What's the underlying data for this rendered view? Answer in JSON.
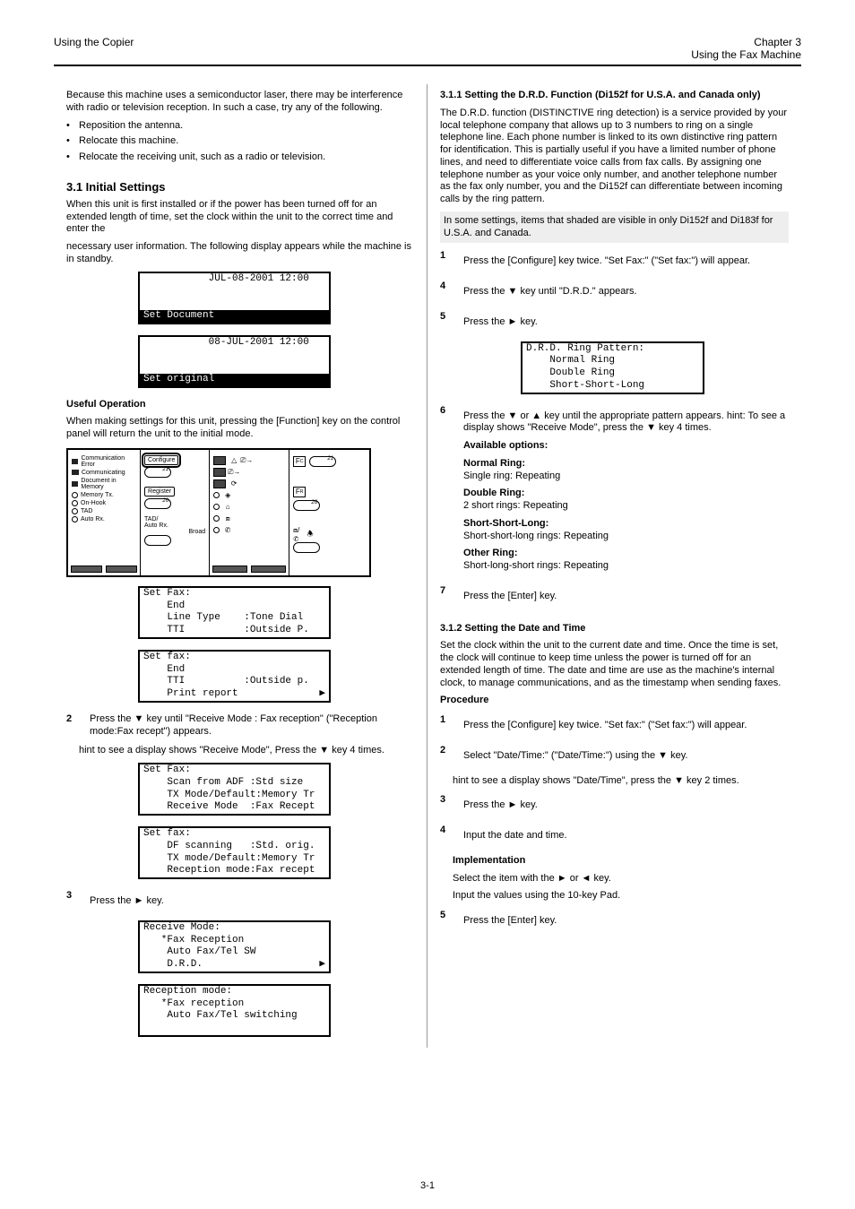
{
  "header": {
    "left": "Using the Copier",
    "right_ch": "Chapter 3",
    "right_title": "Using the Fax Machine"
  },
  "intro": {
    "p1": "Because this machine uses a semiconductor laser, there may be interference with radio or television reception. In such a case, try any of the following.",
    "b1": "Reposition the antenna.",
    "b2": "Relocate this machine.",
    "b3": "Relocate the receiving unit, such as a radio or television."
  },
  "s31": {
    "title": "3.1  Initial Settings",
    "p1a": "When this unit is first installed or if the power has been turned off for an extended length of time, set the clock within the unit to the correct time and enter the",
    "p1b": "necessary user information. The following display appears while the machine is in standby.",
    "disp1_top": "           JUL-08-2001 12:00",
    "disp1_bot": "Set Document",
    "disp1_blank": "                            ",
    "disp2_top": "           08-JUL-2001 12:00",
    "disp2_bot": "Set original"
  },
  "useful": {
    "title": "Useful Operation",
    "p": "When making settings for this unit, pressing the [Function] key on the control panel will return the unit to the initial mode.",
    "panel": {
      "col1": [
        "Communication Error",
        "Communicating",
        "Document in Memory",
        "Memory Tx.",
        "On-Hook",
        "TAD",
        "Auto Rx."
      ],
      "cfg": "Configure",
      "reg": "Register",
      "tad": "TAD/\nAuto Rx.",
      "broad": "Broad"
    }
  },
  "s311": {
    "title": "3.1.1 Setting the D.R.D. Function (Di152f for U.S.A. and Canada only)",
    "p": "The D.R.D. function (DISTINCTIVE ring detection) is a service provided by your local telephone company that allows up to 3 numbers to ring on a single telephone line. Each phone number is linked to its own distinctive ring pattern for identification. This is partially useful if you have a limited number of phone lines, and need to differentiate voice calls from fax calls. By assigning one telephone number as your voice only number, and another telephone number as the fax only number, you and the Di152f can differentiate between incoming calls by the ring pattern."
  },
  "shading_note": "In some settings, items that shaded are visible in only Di152f and Di183f for U.S.A. and Canada.",
  "step1": {
    "num": "1",
    "text": "Press the [Configure] key twice. \"Set Fax:\" (\"Set fax:\") will appear."
  },
  "sf1": {
    "title": "Set Fax:",
    "l1": "    End",
    "l2": "    Line Type    :Tone Dial",
    "l3": "    TTI          :Outside P."
  },
  "sf2": {
    "title": "Set fax:",
    "l1": "    End",
    "l2": "    TTI          :Outside p.",
    "l3": "    Print report"
  },
  "step2": {
    "num": "2",
    "text_a": "Press the ▼ key until \"Receive Mode : Fax reception\" (\"Reception mode:Fax recept\") appears.",
    "text_b": "hint to see a display shows \"Receive Mode\", Press the ▼ key 4 times."
  },
  "sf3": {
    "title": "Set Fax:",
    "l1": "    Scan from ADF :Std size",
    "l2": "    TX Mode/Default:Memory Tr",
    "l3": "    Receive Mode  :Fax Recept"
  },
  "sf4": {
    "title": "Set fax:",
    "l1": "    DF scanning   :Std. orig.",
    "l2": "    TX mode/Default:Memory Tr",
    "l3": "    Reception mode:Fax recept"
  },
  "step3": {
    "num": "3",
    "text": "Press the ► key."
  },
  "rm1": {
    "title": "Receive Mode:",
    "l1": "   *Fax Reception",
    "l2": "    Auto Fax/Tel SW",
    "l3": "    D.R.D."
  },
  "rm2": {
    "title": "Reception mode:",
    "l1": "   *Fax reception",
    "l2": "    Auto Fax/Tel switching",
    "l3": " "
  },
  "step4": {
    "num": "4",
    "text": "Press the ▼ key until \"D.R.D.\" appears."
  },
  "step5": {
    "num": "5",
    "text": "Press the ► key."
  },
  "drd": {
    "title": "D.R.D. Ring Pattern:",
    "l1": "    Normal Ring",
    "l2": "    Double Ring",
    "l3": "    Short-Short-Long"
  },
  "step6": {
    "num": "6",
    "text": "Press the ▼ or ▲ key until the appropriate pattern appears. hint: To see a display shows \"Receive Mode\", press the ▼ key 4 times.",
    "opts_label": "Available options:",
    "o1": "Normal Ring:",
    "o1d": "Single ring: Repeating",
    "o2": "Double Ring:",
    "o2d": "2 short rings: Repeating",
    "o3": "Short-Short-Long:",
    "o3d": "Short-short-long rings: Repeating",
    "o4": "Other Ring:",
    "o4d": "Short-long-short rings: Repeating"
  },
  "step7": {
    "num": "7",
    "text": "Press the [Enter] key."
  },
  "s312": {
    "title": "3.1.2 Setting the Date and Time",
    "p": "Set the clock within the unit to the current date and time. Once the time is set, the clock will continue to keep time unless the power is turned off for an extended length of time. The date and time are use as the machine's internal clock, to manage communications, and as the timestamp when sending faxes."
  },
  "procedure": {
    "title": "Procedure",
    "s1n": "1",
    "s1": "Press the [Configure] key twice. \"Set fax:\" (\"Set fax:\") will appear.",
    "s2n": "2",
    "s2": "Select \"Date/Time:\" (\"Date/Time:\") using the ▼ key.",
    "hint": "hint to see a display shows \"Date/Time\", press the ▼ key 2 times.",
    "s3n": "3",
    "s3": "Press the ► key.",
    "s4n": "4",
    "s4": "Input the date and time.",
    "impl": "Implementation",
    "s4a": "Select the item with the ► or ◄ key.",
    "s4b": "Input the values using the 10-key Pad.",
    "s5n": "5",
    "s5": "Press the [Enter] key."
  },
  "footer": "3-1"
}
